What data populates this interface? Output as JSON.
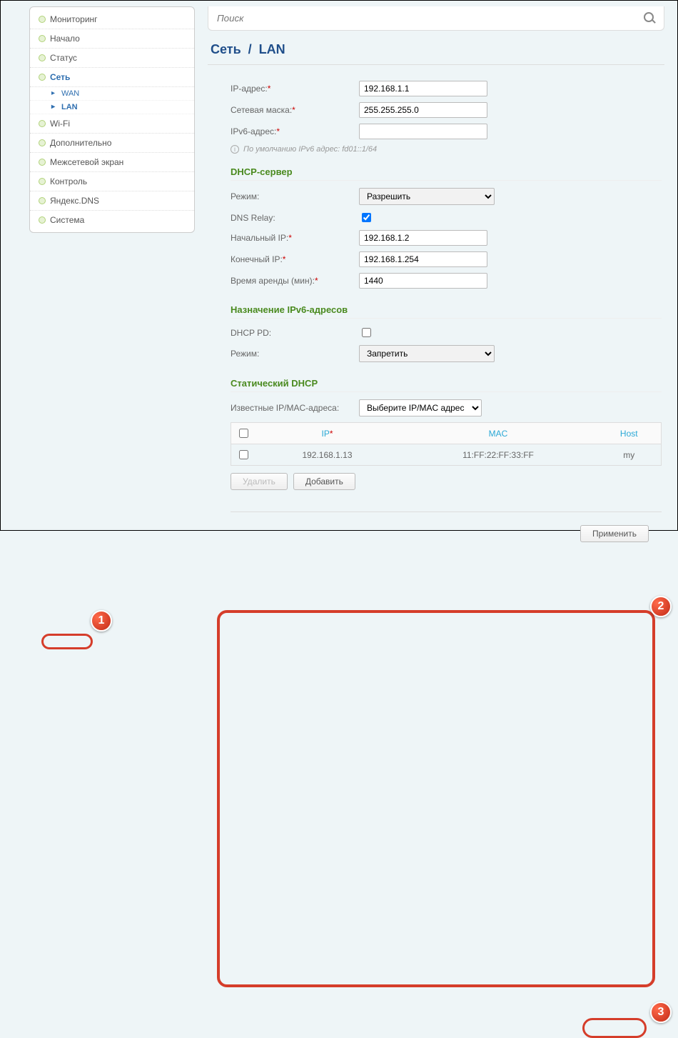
{
  "sidebar": {
    "items": [
      {
        "label": "Мониторинг"
      },
      {
        "label": "Начало"
      },
      {
        "label": "Статус"
      },
      {
        "label": "Сеть",
        "expanded": true,
        "children": [
          {
            "label": "WAN"
          },
          {
            "label": "LAN",
            "active": true
          }
        ]
      },
      {
        "label": "Wi-Fi"
      },
      {
        "label": "Дополнительно"
      },
      {
        "label": "Межсетевой экран"
      },
      {
        "label": "Контроль"
      },
      {
        "label": "Яндекс.DNS"
      },
      {
        "label": "Система"
      }
    ]
  },
  "search": {
    "placeholder": "Поиск"
  },
  "breadcrumb": {
    "section": "Сеть",
    "page": "LAN"
  },
  "basic": {
    "ip_label": "IP-адрес:",
    "ip_value": "192.168.1.1",
    "mask_label": "Сетевая маска:",
    "mask_value": "255.255.255.0",
    "ipv6_label": "IPv6-адрес:",
    "ipv6_value": "",
    "hint": "По умолчанию IPv6 адрес: fd01::1/64"
  },
  "dhcp": {
    "title": "DHCP-сервер",
    "mode_label": "Режим:",
    "mode_value": "Разрешить",
    "relay_label": "DNS Relay:",
    "relay_checked": true,
    "start_label": "Начальный IP:",
    "start_value": "192.168.1.2",
    "end_label": "Конечный IP:",
    "end_value": "192.168.1.254",
    "lease_label": "Время аренды (мин):",
    "lease_value": "1440"
  },
  "ipv6": {
    "title": "Назначение IPv6-адресов",
    "pd_label": "DHCP PD:",
    "pd_checked": false,
    "mode_label": "Режим:",
    "mode_value": "Запретить"
  },
  "static": {
    "title": "Статический DHCP",
    "known_label": "Известные IP/MAC-адреса:",
    "known_value": "Выберите IP/MAC адрес",
    "cols": {
      "ip": "IP",
      "mac": "MAC",
      "host": "Host"
    },
    "rows": [
      {
        "checked": false,
        "ip": "192.168.1.13",
        "mac": "11:FF:22:FF:33:FF",
        "host": "my"
      }
    ],
    "delete_label": "Удалить",
    "add_label": "Добавить"
  },
  "footer": {
    "apply_label": "Применить"
  },
  "callouts": {
    "c1": "1",
    "c2": "2",
    "c3": "3"
  }
}
